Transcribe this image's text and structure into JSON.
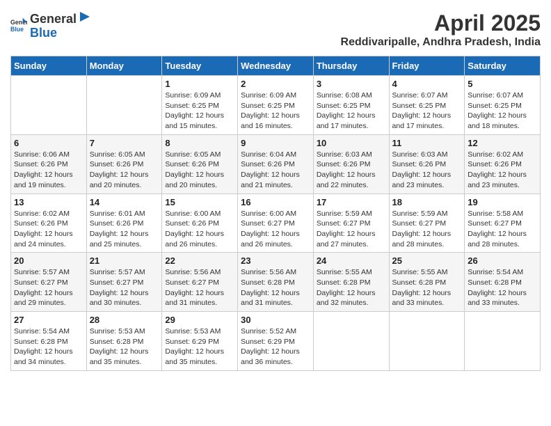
{
  "header": {
    "logo_general": "General",
    "logo_blue": "Blue",
    "month_title": "April 2025",
    "location": "Reddivaripalle, Andhra Pradesh, India"
  },
  "weekdays": [
    "Sunday",
    "Monday",
    "Tuesday",
    "Wednesday",
    "Thursday",
    "Friday",
    "Saturday"
  ],
  "weeks": [
    [
      {
        "day": "",
        "sunrise": "",
        "sunset": "",
        "daylight": ""
      },
      {
        "day": "",
        "sunrise": "",
        "sunset": "",
        "daylight": ""
      },
      {
        "day": "1",
        "sunrise": "Sunrise: 6:09 AM",
        "sunset": "Sunset: 6:25 PM",
        "daylight": "Daylight: 12 hours and 15 minutes."
      },
      {
        "day": "2",
        "sunrise": "Sunrise: 6:09 AM",
        "sunset": "Sunset: 6:25 PM",
        "daylight": "Daylight: 12 hours and 16 minutes."
      },
      {
        "day": "3",
        "sunrise": "Sunrise: 6:08 AM",
        "sunset": "Sunset: 6:25 PM",
        "daylight": "Daylight: 12 hours and 17 minutes."
      },
      {
        "day": "4",
        "sunrise": "Sunrise: 6:07 AM",
        "sunset": "Sunset: 6:25 PM",
        "daylight": "Daylight: 12 hours and 17 minutes."
      },
      {
        "day": "5",
        "sunrise": "Sunrise: 6:07 AM",
        "sunset": "Sunset: 6:25 PM",
        "daylight": "Daylight: 12 hours and 18 minutes."
      }
    ],
    [
      {
        "day": "6",
        "sunrise": "Sunrise: 6:06 AM",
        "sunset": "Sunset: 6:26 PM",
        "daylight": "Daylight: 12 hours and 19 minutes."
      },
      {
        "day": "7",
        "sunrise": "Sunrise: 6:05 AM",
        "sunset": "Sunset: 6:26 PM",
        "daylight": "Daylight: 12 hours and 20 minutes."
      },
      {
        "day": "8",
        "sunrise": "Sunrise: 6:05 AM",
        "sunset": "Sunset: 6:26 PM",
        "daylight": "Daylight: 12 hours and 20 minutes."
      },
      {
        "day": "9",
        "sunrise": "Sunrise: 6:04 AM",
        "sunset": "Sunset: 6:26 PM",
        "daylight": "Daylight: 12 hours and 21 minutes."
      },
      {
        "day": "10",
        "sunrise": "Sunrise: 6:03 AM",
        "sunset": "Sunset: 6:26 PM",
        "daylight": "Daylight: 12 hours and 22 minutes."
      },
      {
        "day": "11",
        "sunrise": "Sunrise: 6:03 AM",
        "sunset": "Sunset: 6:26 PM",
        "daylight": "Daylight: 12 hours and 23 minutes."
      },
      {
        "day": "12",
        "sunrise": "Sunrise: 6:02 AM",
        "sunset": "Sunset: 6:26 PM",
        "daylight": "Daylight: 12 hours and 23 minutes."
      }
    ],
    [
      {
        "day": "13",
        "sunrise": "Sunrise: 6:02 AM",
        "sunset": "Sunset: 6:26 PM",
        "daylight": "Daylight: 12 hours and 24 minutes."
      },
      {
        "day": "14",
        "sunrise": "Sunrise: 6:01 AM",
        "sunset": "Sunset: 6:26 PM",
        "daylight": "Daylight: 12 hours and 25 minutes."
      },
      {
        "day": "15",
        "sunrise": "Sunrise: 6:00 AM",
        "sunset": "Sunset: 6:26 PM",
        "daylight": "Daylight: 12 hours and 26 minutes."
      },
      {
        "day": "16",
        "sunrise": "Sunrise: 6:00 AM",
        "sunset": "Sunset: 6:27 PM",
        "daylight": "Daylight: 12 hours and 26 minutes."
      },
      {
        "day": "17",
        "sunrise": "Sunrise: 5:59 AM",
        "sunset": "Sunset: 6:27 PM",
        "daylight": "Daylight: 12 hours and 27 minutes."
      },
      {
        "day": "18",
        "sunrise": "Sunrise: 5:59 AM",
        "sunset": "Sunset: 6:27 PM",
        "daylight": "Daylight: 12 hours and 28 minutes."
      },
      {
        "day": "19",
        "sunrise": "Sunrise: 5:58 AM",
        "sunset": "Sunset: 6:27 PM",
        "daylight": "Daylight: 12 hours and 28 minutes."
      }
    ],
    [
      {
        "day": "20",
        "sunrise": "Sunrise: 5:57 AM",
        "sunset": "Sunset: 6:27 PM",
        "daylight": "Daylight: 12 hours and 29 minutes."
      },
      {
        "day": "21",
        "sunrise": "Sunrise: 5:57 AM",
        "sunset": "Sunset: 6:27 PM",
        "daylight": "Daylight: 12 hours and 30 minutes."
      },
      {
        "day": "22",
        "sunrise": "Sunrise: 5:56 AM",
        "sunset": "Sunset: 6:27 PM",
        "daylight": "Daylight: 12 hours and 31 minutes."
      },
      {
        "day": "23",
        "sunrise": "Sunrise: 5:56 AM",
        "sunset": "Sunset: 6:28 PM",
        "daylight": "Daylight: 12 hours and 31 minutes."
      },
      {
        "day": "24",
        "sunrise": "Sunrise: 5:55 AM",
        "sunset": "Sunset: 6:28 PM",
        "daylight": "Daylight: 12 hours and 32 minutes."
      },
      {
        "day": "25",
        "sunrise": "Sunrise: 5:55 AM",
        "sunset": "Sunset: 6:28 PM",
        "daylight": "Daylight: 12 hours and 33 minutes."
      },
      {
        "day": "26",
        "sunrise": "Sunrise: 5:54 AM",
        "sunset": "Sunset: 6:28 PM",
        "daylight": "Daylight: 12 hours and 33 minutes."
      }
    ],
    [
      {
        "day": "27",
        "sunrise": "Sunrise: 5:54 AM",
        "sunset": "Sunset: 6:28 PM",
        "daylight": "Daylight: 12 hours and 34 minutes."
      },
      {
        "day": "28",
        "sunrise": "Sunrise: 5:53 AM",
        "sunset": "Sunset: 6:28 PM",
        "daylight": "Daylight: 12 hours and 35 minutes."
      },
      {
        "day": "29",
        "sunrise": "Sunrise: 5:53 AM",
        "sunset": "Sunset: 6:29 PM",
        "daylight": "Daylight: 12 hours and 35 minutes."
      },
      {
        "day": "30",
        "sunrise": "Sunrise: 5:52 AM",
        "sunset": "Sunset: 6:29 PM",
        "daylight": "Daylight: 12 hours and 36 minutes."
      },
      {
        "day": "",
        "sunrise": "",
        "sunset": "",
        "daylight": ""
      },
      {
        "day": "",
        "sunrise": "",
        "sunset": "",
        "daylight": ""
      },
      {
        "day": "",
        "sunrise": "",
        "sunset": "",
        "daylight": ""
      }
    ]
  ]
}
